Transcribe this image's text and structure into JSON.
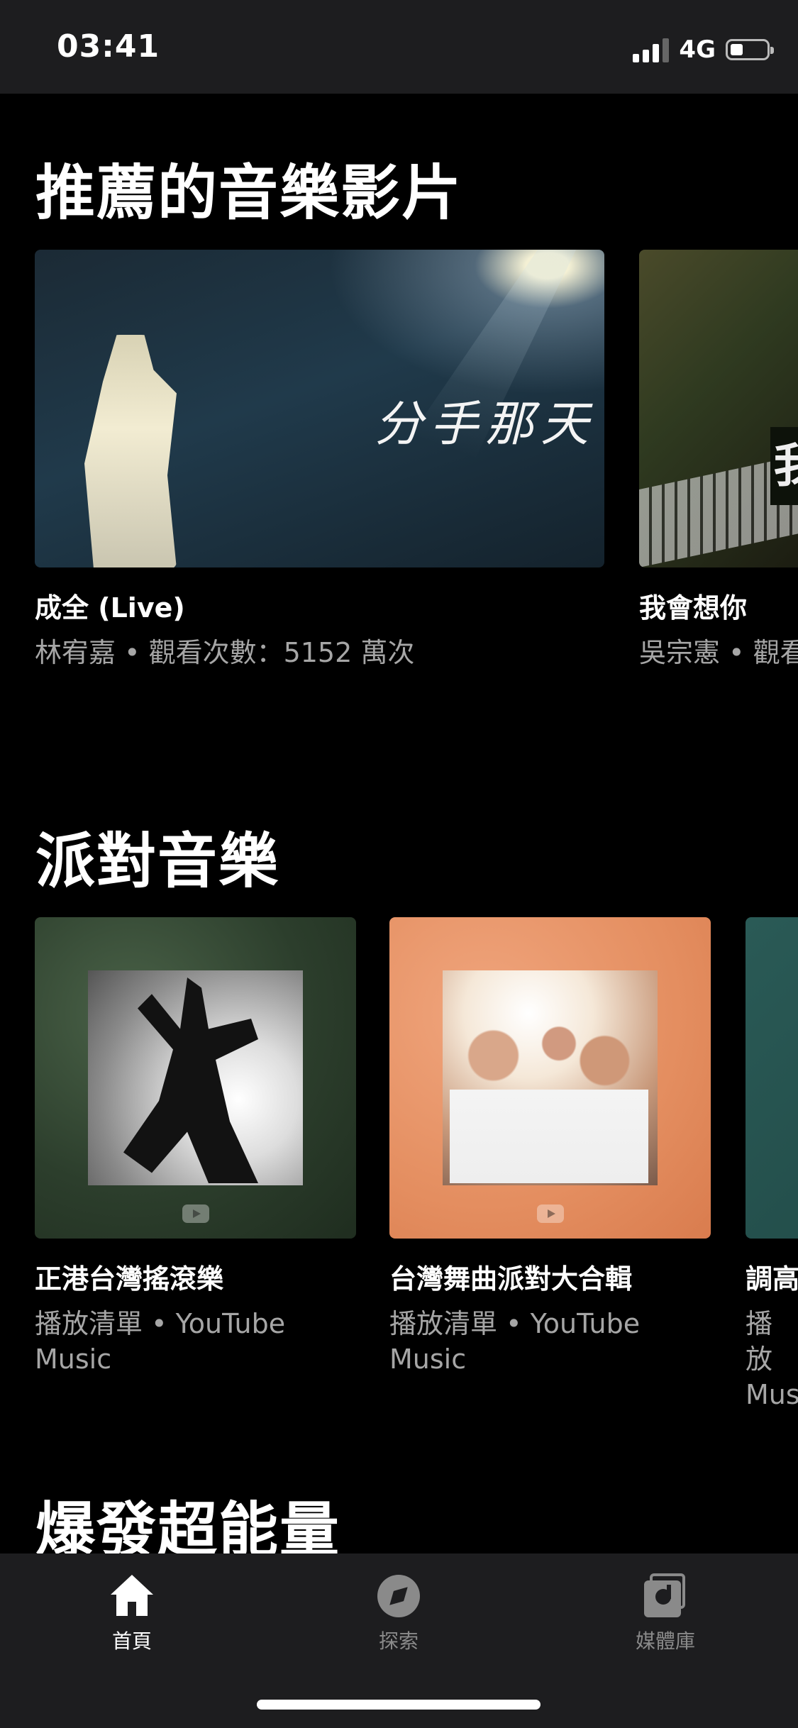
{
  "status_bar": {
    "time": "03:41",
    "network": "4G"
  },
  "sections": [
    {
      "title": "推薦的音樂影片",
      "cards": [
        {
          "title": "成全 (Live)",
          "subtitle": "林宥嘉 • 觀看次數：5152 萬次",
          "thumb_text": "分手那天"
        },
        {
          "title": "我會想你",
          "subtitle": "吳宗憲 • 觀看",
          "thumb_text": "我"
        }
      ]
    },
    {
      "title": "派對音樂",
      "cards": [
        {
          "title": "正港台灣搖滾樂",
          "subtitle": "播放清單 • YouTube Music"
        },
        {
          "title": "台灣舞曲派對大合輯",
          "subtitle": "播放清單 • YouTube Music"
        },
        {
          "title": "調高",
          "subtitle": "播放 Mus"
        }
      ]
    },
    {
      "title": "爆發超能量"
    }
  ],
  "bottom_nav": [
    {
      "label": "首頁",
      "icon": "home-icon",
      "active": true
    },
    {
      "label": "探索",
      "icon": "compass-icon",
      "active": false
    },
    {
      "label": "媒體庫",
      "icon": "library-icon",
      "active": false
    }
  ],
  "colors": {
    "background": "#000000",
    "bar_background": "#1d1d1f",
    "secondary_text": "#a6a6a6",
    "inactive_nav": "#8a8a8a"
  }
}
